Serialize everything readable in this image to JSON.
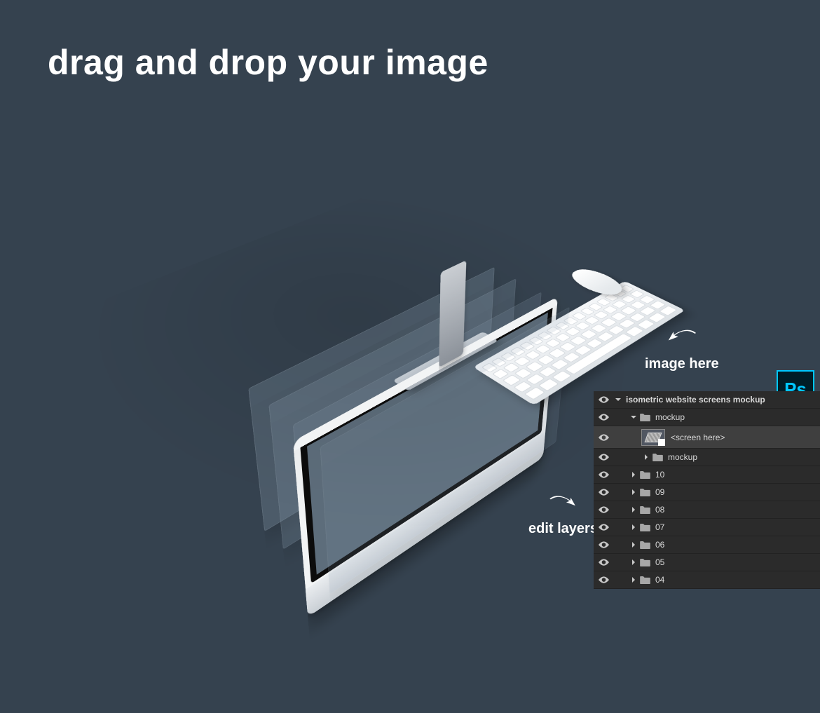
{
  "headline": "drag and drop your image",
  "annotations": {
    "image_here": "image here",
    "edit_layers": "edit layers"
  },
  "ps_label": "Ps",
  "layers_panel": {
    "root": "isometric website screens mockup",
    "mockup_group": "mockup",
    "screen_layer": "<screen here>",
    "nested_mockup": "mockup",
    "rows": [
      {
        "label": "10"
      },
      {
        "label": "09"
      },
      {
        "label": "08"
      },
      {
        "label": "07"
      },
      {
        "label": "06"
      },
      {
        "label": "05"
      },
      {
        "label": "04"
      }
    ]
  }
}
